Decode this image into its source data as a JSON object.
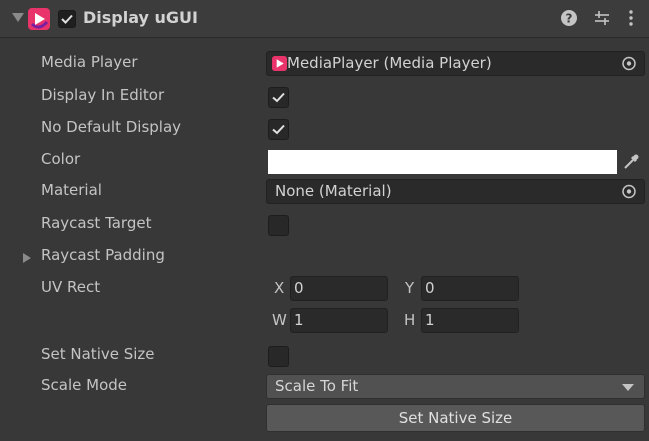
{
  "component": {
    "title": "Display uGUI",
    "enabled": true,
    "icons": {
      "component": "media-player-icon",
      "help": "help-icon",
      "presets": "presets-icon",
      "menu": "kebab-menu-icon"
    }
  },
  "fields": {
    "media_player": {
      "label": "Media Player",
      "value": "MediaPlayer (Media Player)"
    },
    "display_in_editor": {
      "label": "Display In Editor",
      "checked": true
    },
    "no_default_display": {
      "label": "No Default Display",
      "checked": true
    },
    "color": {
      "label": "Color",
      "value": "#ffffff"
    },
    "material": {
      "label": "Material",
      "value": "None (Material)"
    },
    "raycast_target": {
      "label": "Raycast Target",
      "checked": false
    },
    "raycast_padding": {
      "label": "Raycast Padding",
      "expanded": false
    },
    "uv_rect": {
      "label": "UV Rect",
      "x_label": "X",
      "x": "0",
      "y_label": "Y",
      "y": "0",
      "w_label": "W",
      "w": "1",
      "h_label": "H",
      "h": "1"
    },
    "set_native_size_toggle": {
      "label": "Set Native Size",
      "checked": false
    },
    "scale_mode": {
      "label": "Scale Mode",
      "value": "Scale To Fit"
    }
  },
  "button": {
    "label": "Set Native Size"
  },
  "colors": {
    "background": "#383838",
    "header": "#3c3c3c",
    "field": "#2a2a2a",
    "accent": "#e8336b"
  }
}
